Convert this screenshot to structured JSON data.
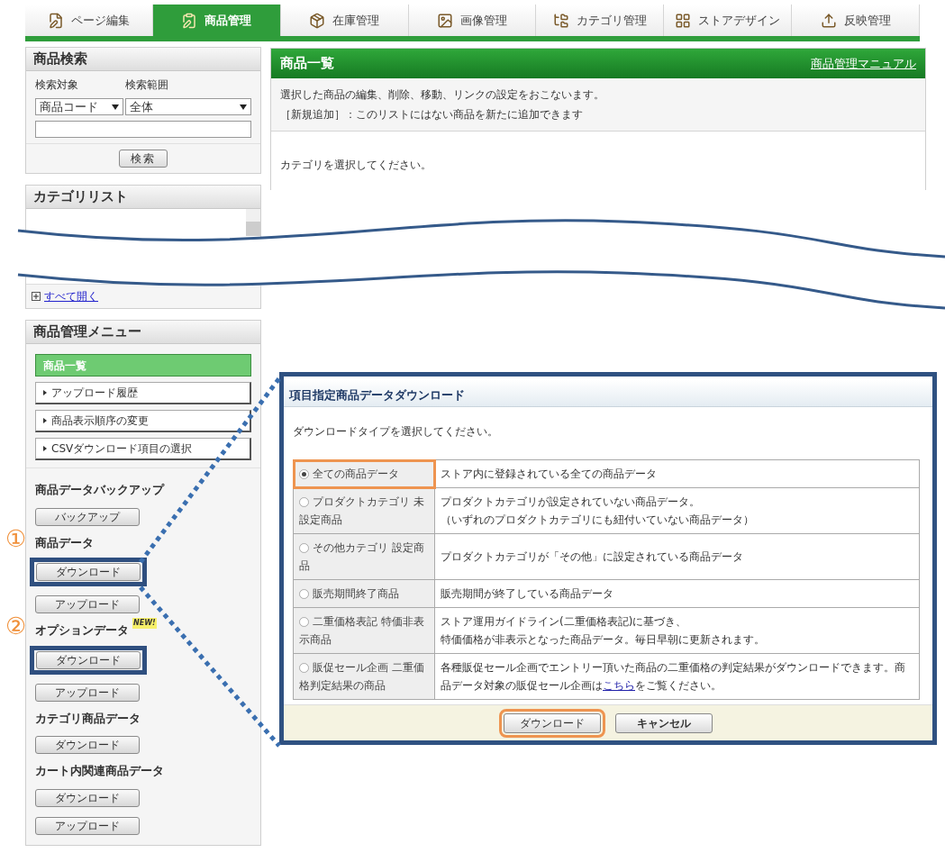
{
  "tabs": [
    {
      "label": "ページ編集",
      "selected": false
    },
    {
      "label": "商品管理",
      "selected": true
    },
    {
      "label": "在庫管理",
      "selected": false
    },
    {
      "label": "画像管理",
      "selected": false
    },
    {
      "label": "カテゴリ管理",
      "selected": false
    },
    {
      "label": "ストアデザイン",
      "selected": false
    },
    {
      "label": "反映管理",
      "selected": false
    }
  ],
  "search_panel": {
    "title": "商品検索",
    "target_label": "検索対象",
    "range_label": "検索範囲",
    "target_select": "商品コード",
    "range_select": "全体",
    "search_button": "検索"
  },
  "category_panel": {
    "title": "カテゴリリスト",
    "expand_link": "すべて開く"
  },
  "menu_panel": {
    "title": "商品管理メニュー",
    "items": [
      {
        "label": "商品一覧",
        "selected": true
      },
      {
        "label": "アップロード履歴",
        "selected": false
      },
      {
        "label": "商品表示順序の変更",
        "selected": false
      },
      {
        "label": "CSVダウンロード項目の選択",
        "selected": false
      }
    ],
    "sections": [
      {
        "title": "商品データバックアップ",
        "buttons": [
          {
            "label": "バックアップ",
            "highlighted": false
          }
        ]
      },
      {
        "title": "商品データ",
        "marker": "①",
        "buttons": [
          {
            "label": "ダウンロード",
            "highlighted": true
          },
          {
            "label": "アップロード",
            "highlighted": false
          }
        ]
      },
      {
        "title": "オプションデータ",
        "marker": "②",
        "badge": "NEW!",
        "buttons": [
          {
            "label": "ダウンロード",
            "highlighted": true
          },
          {
            "label": "アップロード",
            "highlighted": false
          }
        ]
      },
      {
        "title": "カテゴリ商品データ",
        "buttons": [
          {
            "label": "ダウンロード",
            "highlighted": false
          }
        ]
      },
      {
        "title": "カート内関連商品データ",
        "buttons": [
          {
            "label": "ダウンロード",
            "highlighted": false
          },
          {
            "label": "アップロード",
            "highlighted": false
          }
        ]
      }
    ]
  },
  "list_panel": {
    "title": "商品一覧",
    "manual_link": "商品管理マニュアル",
    "description": [
      "選択した商品の編集、削除、移動、リンクの設定をおこないます。",
      "［新規追加］：このリストにはない商品を新たに追加できます"
    ],
    "message": "カテゴリを選択してください。"
  },
  "dialog": {
    "title": "項目指定商品データダウンロード",
    "prompt": "ダウンロードタイプを選択してください。",
    "options": [
      {
        "label": "全ての商品データ",
        "selected": true,
        "highlighted": true,
        "description": [
          "ストア内に登録されている全ての商品データ"
        ]
      },
      {
        "label": "プロダクトカテゴリ 未設定商品",
        "selected": false,
        "highlighted": false,
        "description": [
          "プロダクトカテゴリが設定されていない商品データ。",
          "（いずれのプロダクトカテゴリにも紐付いていない商品データ）"
        ]
      },
      {
        "label": "その他カテゴリ 設定商品",
        "selected": false,
        "highlighted": false,
        "description": [
          "プロダクトカテゴリが「その他」に設定されている商品データ"
        ]
      },
      {
        "label": "販売期間終了商品",
        "selected": false,
        "highlighted": false,
        "description": [
          "販売期間が終了している商品データ"
        ]
      },
      {
        "label": "二重価格表記 特価非表示商品",
        "selected": false,
        "highlighted": false,
        "description": [
          "ストア運用ガイドライン(二重価格表記)に基づき、",
          "特価価格が非表示となった商品データ。毎日早朝に更新されます。"
        ]
      },
      {
        "label": "販促セール企画 二重価格判定結果の商品",
        "selected": false,
        "highlighted": false,
        "description": [
          "各種販促セール企画でエントリー頂いた商品の二重価格の判定結果がダウンロードできます。商品データ対象の販促セール企画は"
        ],
        "link": "こちら",
        "description_after": "をご覧ください。"
      }
    ],
    "buttons": [
      {
        "label": "ダウンロード",
        "highlighted": true
      },
      {
        "label": "キャンセル",
        "highlighted": false
      }
    ]
  }
}
